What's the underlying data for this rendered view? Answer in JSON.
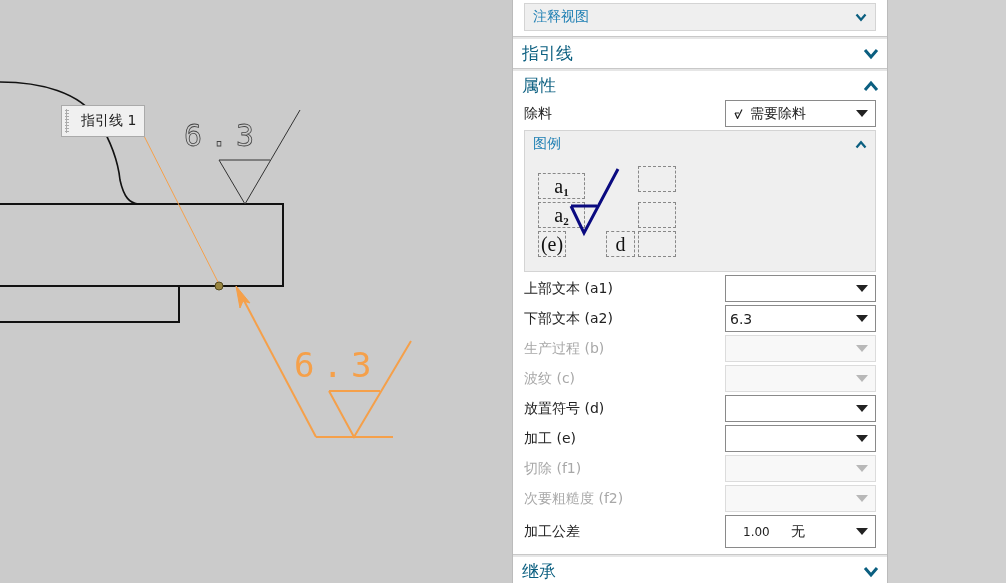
{
  "canvas": {
    "leader_tag": "指引线 1",
    "placed_symbol": {
      "text": "6.3"
    },
    "preview_symbol": {
      "text": "6.3"
    }
  },
  "panel": {
    "top_group": {
      "title": "注释视图",
      "expanded": false
    },
    "sections": [
      {
        "title": "指引线",
        "expanded": false
      },
      {
        "title": "属性",
        "expanded": true,
        "removal": {
          "label": "除料",
          "value": "需要除料"
        },
        "legend": {
          "title": "图例",
          "expanded": true,
          "slots": [
            "a$_{1}$",
            "a$_{2}$",
            "(e)",
            "d"
          ]
        },
        "fields": [
          {
            "kind": "dropdown",
            "label": "上部文本 (a1)",
            "disabled": false
          },
          {
            "kind": "dropdown",
            "label": "下部文本 (a2)",
            "value": "6.3",
            "disabled": false
          },
          {
            "kind": "dropdown",
            "label": "生产过程 (b)",
            "disabled": true
          },
          {
            "kind": "dropdown",
            "label": "波纹 (c)",
            "disabled": true
          },
          {
            "kind": "dropdown",
            "label": "放置符号 (d)",
            "disabled": false
          },
          {
            "kind": "dropdown",
            "label": "加工 (e)",
            "disabled": false
          },
          {
            "kind": "dropdown",
            "label": "切除 (f1)",
            "disabled": true
          },
          {
            "kind": "dropdown",
            "label": "次要粗糙度 (f2)",
            "disabled": true
          },
          {
            "kind": "tolerance",
            "label": "加工公差",
            "value": "1.00",
            "unit": "无",
            "disabled": false
          }
        ]
      },
      {
        "title": "继承",
        "expanded": false
      }
    ]
  }
}
